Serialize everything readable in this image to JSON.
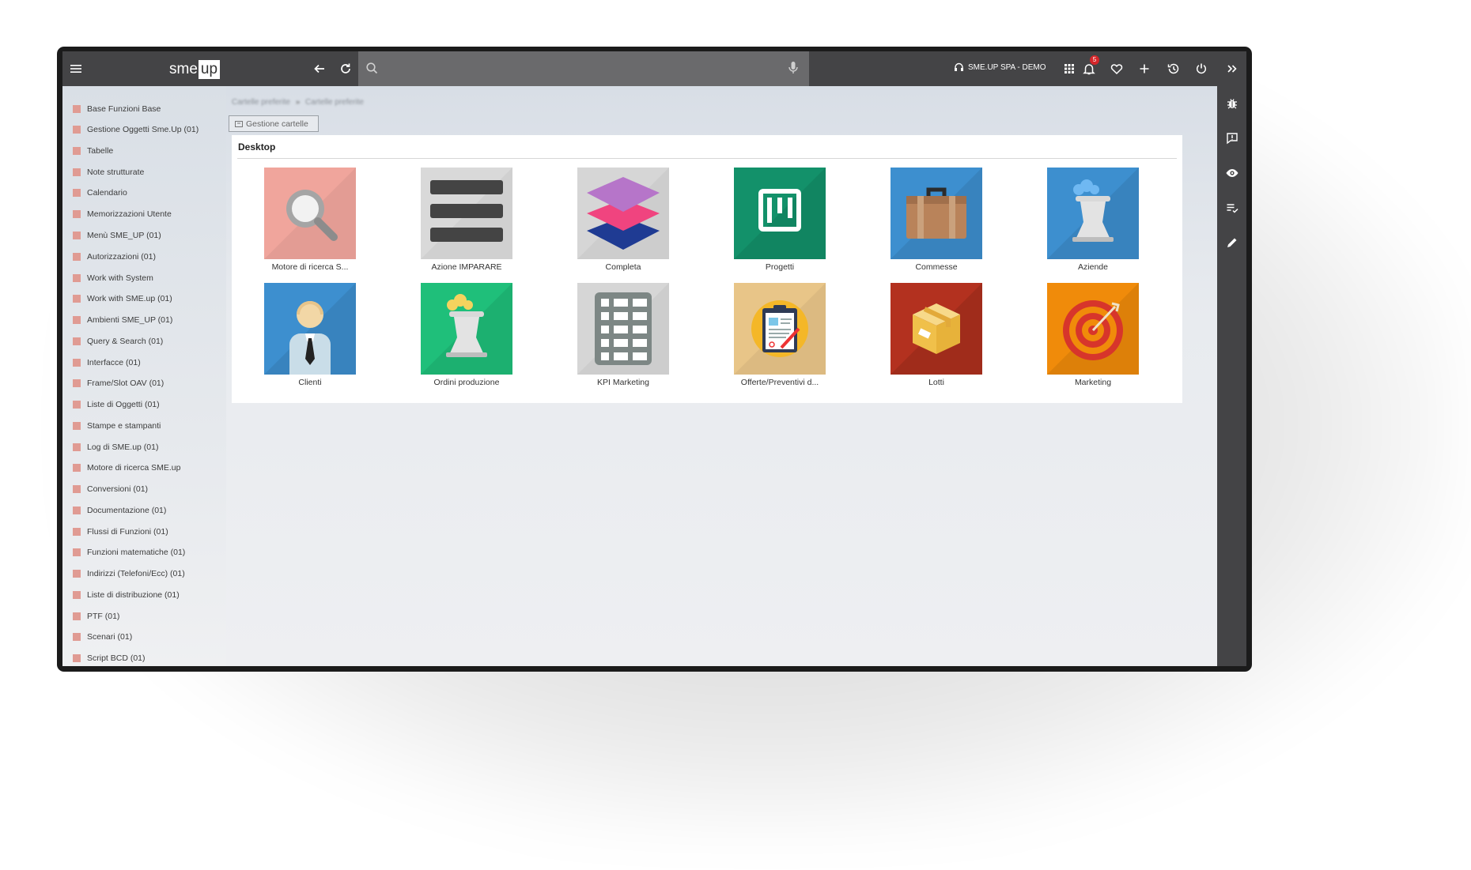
{
  "app": {
    "logo_part1": "sme",
    "logo_part2": "up"
  },
  "topbar": {
    "search_placeholder": "",
    "company": "SME.UP SPA - DEMO",
    "notification_count": "5"
  },
  "sidebar": {
    "items": [
      "Base Funzioni Base",
      "Gestione Oggetti Sme.Up (01)",
      "Tabelle",
      "Note strutturate",
      "Calendario",
      "Memorizzazioni Utente",
      "Menù SME_UP (01)",
      "Autorizzazioni (01)",
      "Work with System",
      "Work with SME.up (01)",
      "Ambienti SME_UP (01)",
      "Query & Search (01)",
      "Interfacce (01)",
      "Frame/Slot OAV (01)",
      "Liste di Oggetti (01)",
      "Stampe e stampanti",
      "Log di SME.up (01)",
      "Motore di ricerca SME.up",
      "Conversioni (01)",
      "Documentazione (01)",
      "Flussi di Funzioni (01)",
      "Funzioni matematiche (01)",
      "Indirizzi (Telefoni/Ecc) (01)",
      "Liste di distribuzione (01)",
      "PTF (01)",
      "Scenari (01)",
      "Script BCD (01)"
    ],
    "colors": {
      "marker": "#e09b93"
    }
  },
  "main": {
    "breadcrumb": [
      "Cartelle preferite",
      "Cartelle preferite"
    ],
    "breadcrumb_sep": "»",
    "folder_button": "Gestione cartelle",
    "panel_title": "Desktop",
    "tiles": [
      {
        "label": "Motore di ricerca S...",
        "icon": "magnifier-icon",
        "bg": "#f0a59c"
      },
      {
        "label": "Azione IMPARARE",
        "icon": "list-bars-icon",
        "bg": "#d9d9d9"
      },
      {
        "label": "Completa",
        "icon": "layers-icon",
        "bg": "#d6d6d6"
      },
      {
        "label": "Progetti",
        "icon": "kanban-board-icon",
        "bg": "#13916a"
      },
      {
        "label": "Commesse",
        "icon": "briefcase-icon",
        "bg": "#3d8fcf"
      },
      {
        "label": "Aziende",
        "icon": "factory-icon",
        "bg": "#3d8fcf"
      },
      {
        "label": "Clienti",
        "icon": "person-icon",
        "bg": "#3d8fcf"
      },
      {
        "label": "Ordini produzione",
        "icon": "production-icon",
        "bg": "#1fbf7a"
      },
      {
        "label": "KPI Marketing",
        "icon": "spreadsheet-icon",
        "bg": "#d6d6d6"
      },
      {
        "label": "Offerte/Preventivi d...",
        "icon": "clipboard-icon",
        "bg": "#e8c588"
      },
      {
        "label": "Lotti",
        "icon": "box-icon",
        "bg": "#b3311f"
      },
      {
        "label": "Marketing",
        "icon": "target-icon",
        "bg": "#f08b0a"
      }
    ]
  }
}
